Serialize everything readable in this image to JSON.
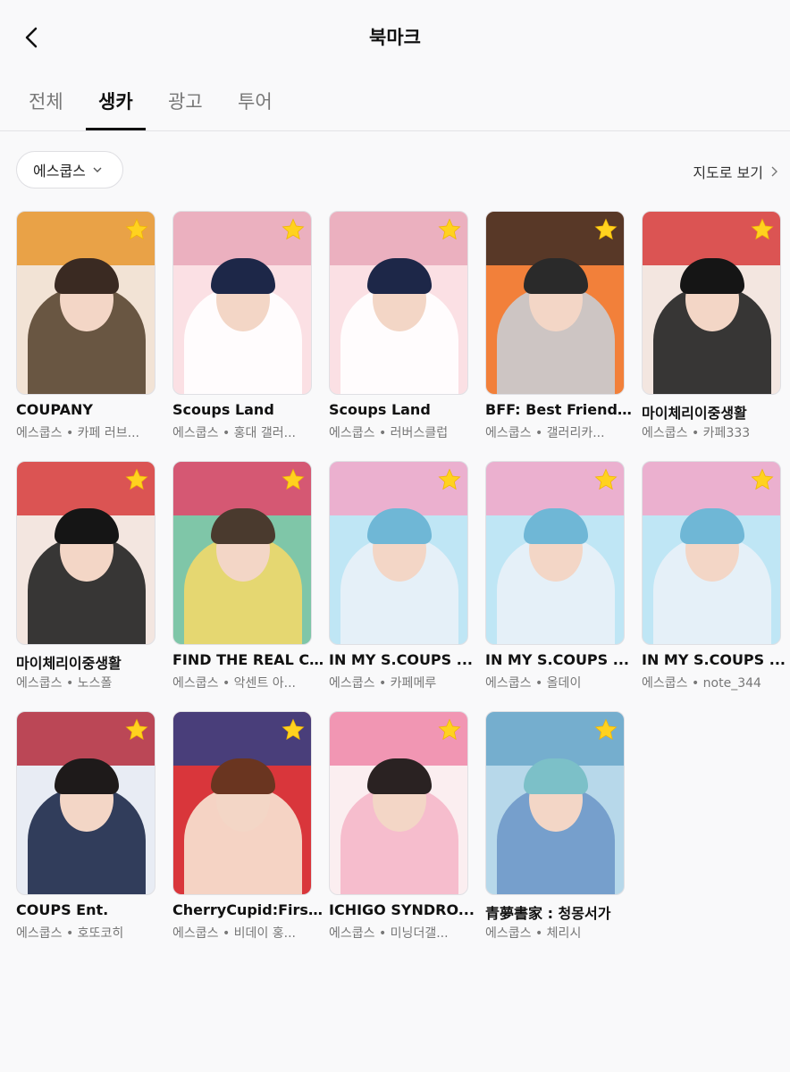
{
  "header": {
    "title": "북마크"
  },
  "tabs": [
    {
      "label": "전체"
    },
    {
      "label": "생카"
    },
    {
      "label": "광고"
    },
    {
      "label": "투어"
    }
  ],
  "filter": {
    "label": "에스쿱스"
  },
  "map_link": {
    "label": "지도로 보기"
  },
  "colors": {
    "star": "#ffd21f",
    "active_tab": "#111111"
  },
  "cards": [
    {
      "name": "COUPANY",
      "subtitle": "에스쿱스 • 카페 러브...",
      "bg": "#f2e3d5",
      "accent": "#e8962e",
      "hair": "#3a2a22",
      "body": "#5a4632"
    },
    {
      "name": "Scoups Land",
      "subtitle": "에스쿱스 • 홍대 갤러...",
      "bg": "#fbe0e4",
      "accent": "#e8a7b9",
      "hair": "#1d2748",
      "body": "#ffffff"
    },
    {
      "name": "Scoups Land",
      "subtitle": "에스쿱스 • 러버스클럽",
      "bg": "#fbe0e4",
      "accent": "#e8a7b9",
      "hair": "#1d2748",
      "body": "#ffffff"
    },
    {
      "name": "BFF: Best Friends ...",
      "subtitle": "에스쿱스 • 갤러리카...",
      "bg": "#f2803a",
      "accent": "#3d2c24",
      "hair": "#2a2a2a",
      "body": "#c9ccd3"
    },
    {
      "name": "마이체리이중생활",
      "subtitle": "에스쿱스 • 카페333",
      "bg": "#f3e6e0",
      "accent": "#d63a3a",
      "hair": "#151515",
      "body": "#222222"
    },
    {
      "name": "마이체리이중생활",
      "subtitle": "에스쿱스 • 노스폴",
      "bg": "#f3e6e0",
      "accent": "#d63a3a",
      "hair": "#151515",
      "body": "#222222"
    },
    {
      "name": "FIND THE REAL C...",
      "subtitle": "에스쿱스 • 악센트 아...",
      "bg": "#7fc6a8",
      "accent": "#e4446a",
      "hair": "#4a3a2e",
      "body": "#f1d86a"
    },
    {
      "name": "IN MY S.COUPS ...",
      "subtitle": "에스쿱스 • 카페메루",
      "bg": "#bfe6f5",
      "accent": "#f2a6c8",
      "hair": "#6fb7d6",
      "body": "#e9f1f8"
    },
    {
      "name": "IN MY S.COUPS ...",
      "subtitle": "에스쿱스 • 올데이",
      "bg": "#bfe6f5",
      "accent": "#f2a6c8",
      "hair": "#6fb7d6",
      "body": "#e9f1f8"
    },
    {
      "name": "IN MY S.COUPS ...",
      "subtitle": "에스쿱스 • note_344",
      "bg": "#bfe6f5",
      "accent": "#f2a6c8",
      "hair": "#6fb7d6",
      "body": "#e9f1f8"
    },
    {
      "name": "COUPS Ent.",
      "subtitle": "에스쿱스 • 호또코히",
      "bg": "#e8ecf4",
      "accent": "#b32a3a",
      "hair": "#1e1a1a",
      "body": "#1d2a4a"
    },
    {
      "name": "CherryCupid:Firs...",
      "subtitle": "에스쿱스 • 비데이 홍...",
      "bg": "#d9363b",
      "accent": "#2f3f86",
      "hair": "#6a3520",
      "body": "#f7e4d4"
    },
    {
      "name": "ICHIGO SYNDRO...",
      "subtitle": "에스쿱스 • 미닝더갤...",
      "bg": "#fbeef0",
      "accent": "#ee86a8",
      "hair": "#2a2222",
      "body": "#f5b7c9"
    },
    {
      "name": "青夢書家 : 청몽서가",
      "subtitle": "에스쿱스 • 체리시",
      "bg": "#b7d8ea",
      "accent": "#6aa7c9",
      "hair": "#7cc0c8",
      "body": "#6f99c9"
    }
  ]
}
